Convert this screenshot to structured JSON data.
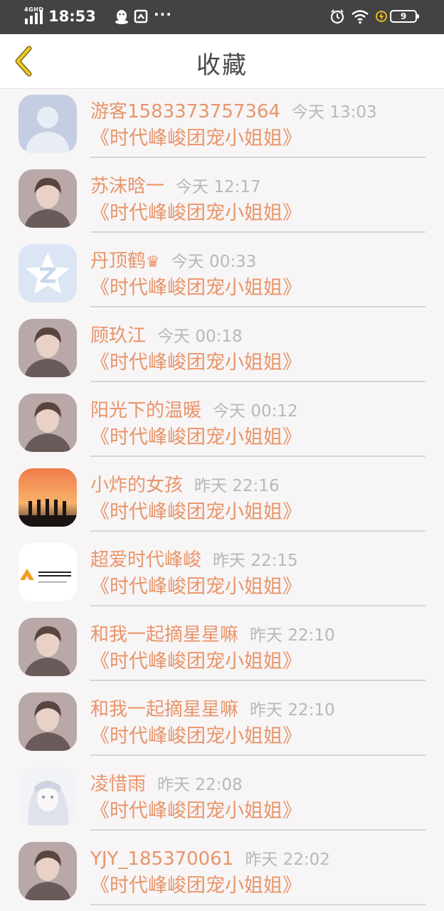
{
  "status_bar": {
    "network": "4GHD",
    "time": "18:53",
    "notification_icons": [
      "qq-penguin-icon",
      "screenshot-icon",
      "crown-icon"
    ],
    "more": "···",
    "battery": "9"
  },
  "header": {
    "back_icon": "chevron-left-icon",
    "title": "收藏"
  },
  "favorites": [
    {
      "user": "游客1583373757364",
      "badge": "",
      "time": "今天 13:03",
      "title": "《时代峰峻团宠小姐姐》",
      "avatar": "default-avatar"
    },
    {
      "user": "苏沫晗一",
      "badge": "",
      "time": "今天 12:17",
      "title": "《时代峰峻团宠小姐姐》",
      "avatar": "photo-avatar"
    },
    {
      "user": "丹顶鹤",
      "badge": "♛",
      "time": "今天 00:33",
      "title": "《时代峰峻团宠小姐姐》",
      "avatar": "qzone-avatar"
    },
    {
      "user": "顾玖江",
      "badge": "",
      "time": "今天 00:18",
      "title": "《时代峰峻团宠小姐姐》",
      "avatar": "photo-avatar"
    },
    {
      "user": "阳光下的温暖",
      "badge": "",
      "time": "今天 00:12",
      "title": "《时代峰峻团宠小姐姐》",
      "avatar": "photo-avatar"
    },
    {
      "user": "小炸的女孩",
      "badge": "",
      "time": "昨天 22:16",
      "title": "《时代峰峻团宠小姐姐》",
      "avatar": "sunset-avatar"
    },
    {
      "user": "超爱时代峰峻",
      "badge": "",
      "time": "昨天 22:15",
      "title": "《时代峰峻团宠小姐姐》",
      "avatar": "logo-avatar"
    },
    {
      "user": "和我一起摘星星嘛",
      "badge": "",
      "time": "昨天 22:10",
      "title": "《时代峰峻团宠小姐姐》",
      "avatar": "photo-avatar"
    },
    {
      "user": "和我一起摘星星嘛",
      "badge": "",
      "time": "昨天 22:10",
      "title": "《时代峰峻团宠小姐姐》",
      "avatar": "photo-avatar"
    },
    {
      "user": "凌惜雨",
      "badge": "",
      "time": "昨天 22:08",
      "title": "《时代峰峻团宠小姐姐》",
      "avatar": "anime-avatar"
    },
    {
      "user": "YJY_185370061",
      "badge": "",
      "time": "昨天 22:02",
      "title": "《时代峰峻团宠小姐姐》",
      "avatar": "photo-avatar"
    }
  ],
  "colors": {
    "accent": "#e8956a",
    "time_gray": "#b8b8b8",
    "back_arrow": "#e8c020",
    "status_bar": "#434343",
    "background": "#f7f5f6"
  }
}
